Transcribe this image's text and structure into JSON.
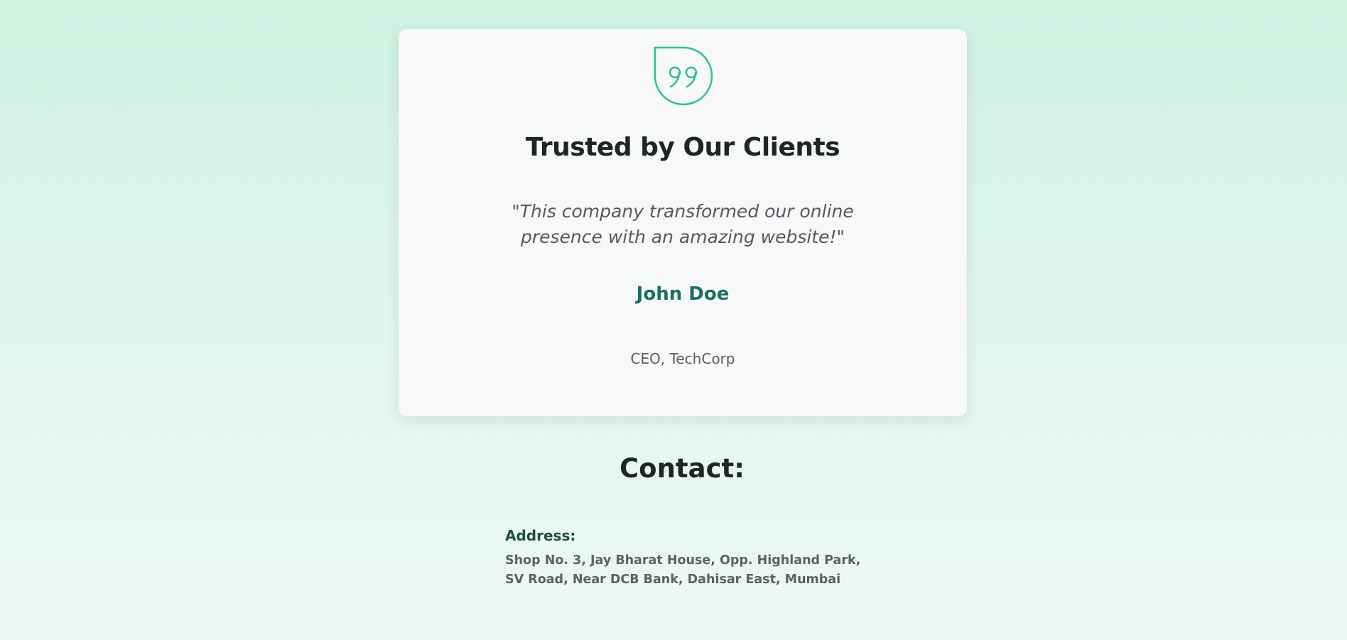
{
  "testimonial": {
    "icon": "quote-bubble-icon",
    "title": "Trusted by Our Clients",
    "quote": "\"This company transformed our online presence with an amazing website!\"",
    "author_name": "John Doe",
    "author_role": "CEO, TechCorp"
  },
  "contact": {
    "heading": "Contact:",
    "address_label": "Address:",
    "address_lines": [
      "Shop No. 3, Jay Bharat House, Opp. Highland Park,",
      "SV Road, Near DCB Bank, Dahisar East, Mumbai"
    ]
  },
  "colors": {
    "accent_green": "#2fbf8f",
    "author_teal": "#1a6e62",
    "card_background": "#f7f8fa",
    "page_background_top": "#cdf1e2",
    "page_background_bottom": "#eef9f4"
  }
}
